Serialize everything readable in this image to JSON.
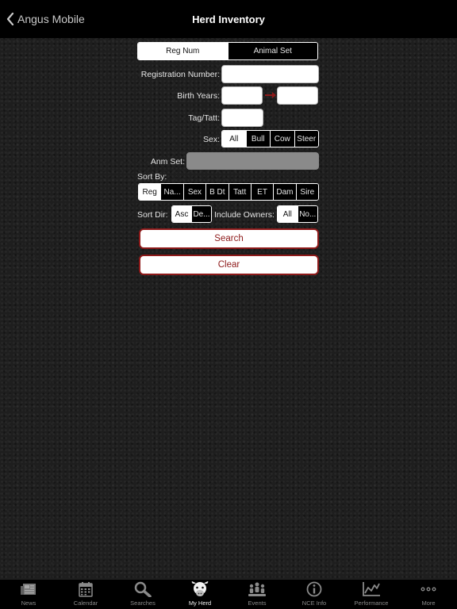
{
  "nav": {
    "back_label": "Angus Mobile",
    "title": "Herd Inventory"
  },
  "mode_tabs": [
    {
      "label": "Reg Num",
      "selected": true
    },
    {
      "label": "Animal Set",
      "selected": false
    }
  ],
  "form": {
    "registration_label": "Registration Number:",
    "registration_value": "",
    "birth_years_label": "Birth Years:",
    "birth_from_value": "",
    "birth_to_value": "",
    "tag_label": "Tag/Tatt:",
    "tag_value": "",
    "sex_label": "Sex:",
    "sex_options": [
      {
        "label": "All",
        "selected": true
      },
      {
        "label": "Bull",
        "selected": false
      },
      {
        "label": "Cow",
        "selected": false
      },
      {
        "label": "Steer",
        "selected": false
      }
    ],
    "anm_set_label": "Anm Set:",
    "anm_set_value": "",
    "sort_by_label": "Sort By:",
    "sort_by_options": [
      {
        "label": "Reg",
        "selected": true
      },
      {
        "label": "Na...",
        "selected": false
      },
      {
        "label": "Sex",
        "selected": false
      },
      {
        "label": "B Dt",
        "selected": false
      },
      {
        "label": "Tatt",
        "selected": false
      },
      {
        "label": "ET",
        "selected": false
      },
      {
        "label": "Dam",
        "selected": false
      },
      {
        "label": "Sire",
        "selected": false
      }
    ],
    "sort_dir_label": "Sort Dir:",
    "sort_dir_options": [
      {
        "label": "Asc",
        "selected": true
      },
      {
        "label": "De...",
        "selected": false
      }
    ],
    "include_owners_label": "Include Owners:",
    "include_owners_options": [
      {
        "label": "All",
        "selected": true
      },
      {
        "label": "No...",
        "selected": false
      }
    ]
  },
  "buttons": {
    "search": "Search",
    "clear": "Clear"
  },
  "colors": {
    "accent": "#8e1a1a",
    "bar": "#000000"
  },
  "tabbar": [
    {
      "label": "News",
      "icon": "news-icon",
      "active": false
    },
    {
      "label": "Calendar",
      "icon": "calendar-icon",
      "active": false
    },
    {
      "label": "Searches",
      "icon": "search-icon",
      "active": false
    },
    {
      "label": "My Herd",
      "icon": "cow-head-icon",
      "active": true
    },
    {
      "label": "Events",
      "icon": "people-icon",
      "active": false
    },
    {
      "label": "NCE Info",
      "icon": "info-icon",
      "active": false
    },
    {
      "label": "Performance",
      "icon": "chart-icon",
      "active": false
    },
    {
      "label": "More",
      "icon": "more-icon",
      "active": false
    }
  ]
}
